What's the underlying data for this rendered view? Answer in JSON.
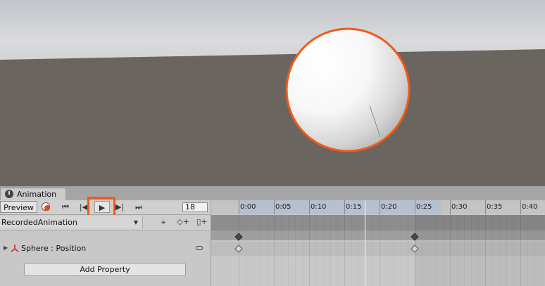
{
  "scene": {
    "sky_color": "#d6d6d8",
    "ground_color": "#6b6560",
    "sphere_outline_color": "#f05a19"
  },
  "animation_window": {
    "tab_label": "Animation",
    "toolbar": {
      "preview_label": "Preview",
      "first_key_icon": "⏮",
      "prev_key_icon": "|◀",
      "play_icon": "▶",
      "next_key_icon": "▶|",
      "last_key_icon": "⏭",
      "frame_value": "18"
    },
    "clip": {
      "name": "RecordedAnimation",
      "dropdown_arrow": "▼",
      "key_icon": "⌖",
      "add_keyframe_icon": "◇+",
      "add_event_icon": "▯+"
    },
    "property": {
      "toggle_icon": "▶",
      "label": "Sphere : Position"
    },
    "add_property_label": "Add Property",
    "timeline": {
      "tick_labels": [
        "0:00",
        "0:05",
        "0:10",
        "0:15",
        "0:20",
        "0:25",
        "0:30",
        "0:35",
        "0:40"
      ],
      "playhead_time": "0:18",
      "keyframe_times": [
        "0:00",
        "0:25"
      ],
      "highlight_color": "#f05a19"
    }
  }
}
